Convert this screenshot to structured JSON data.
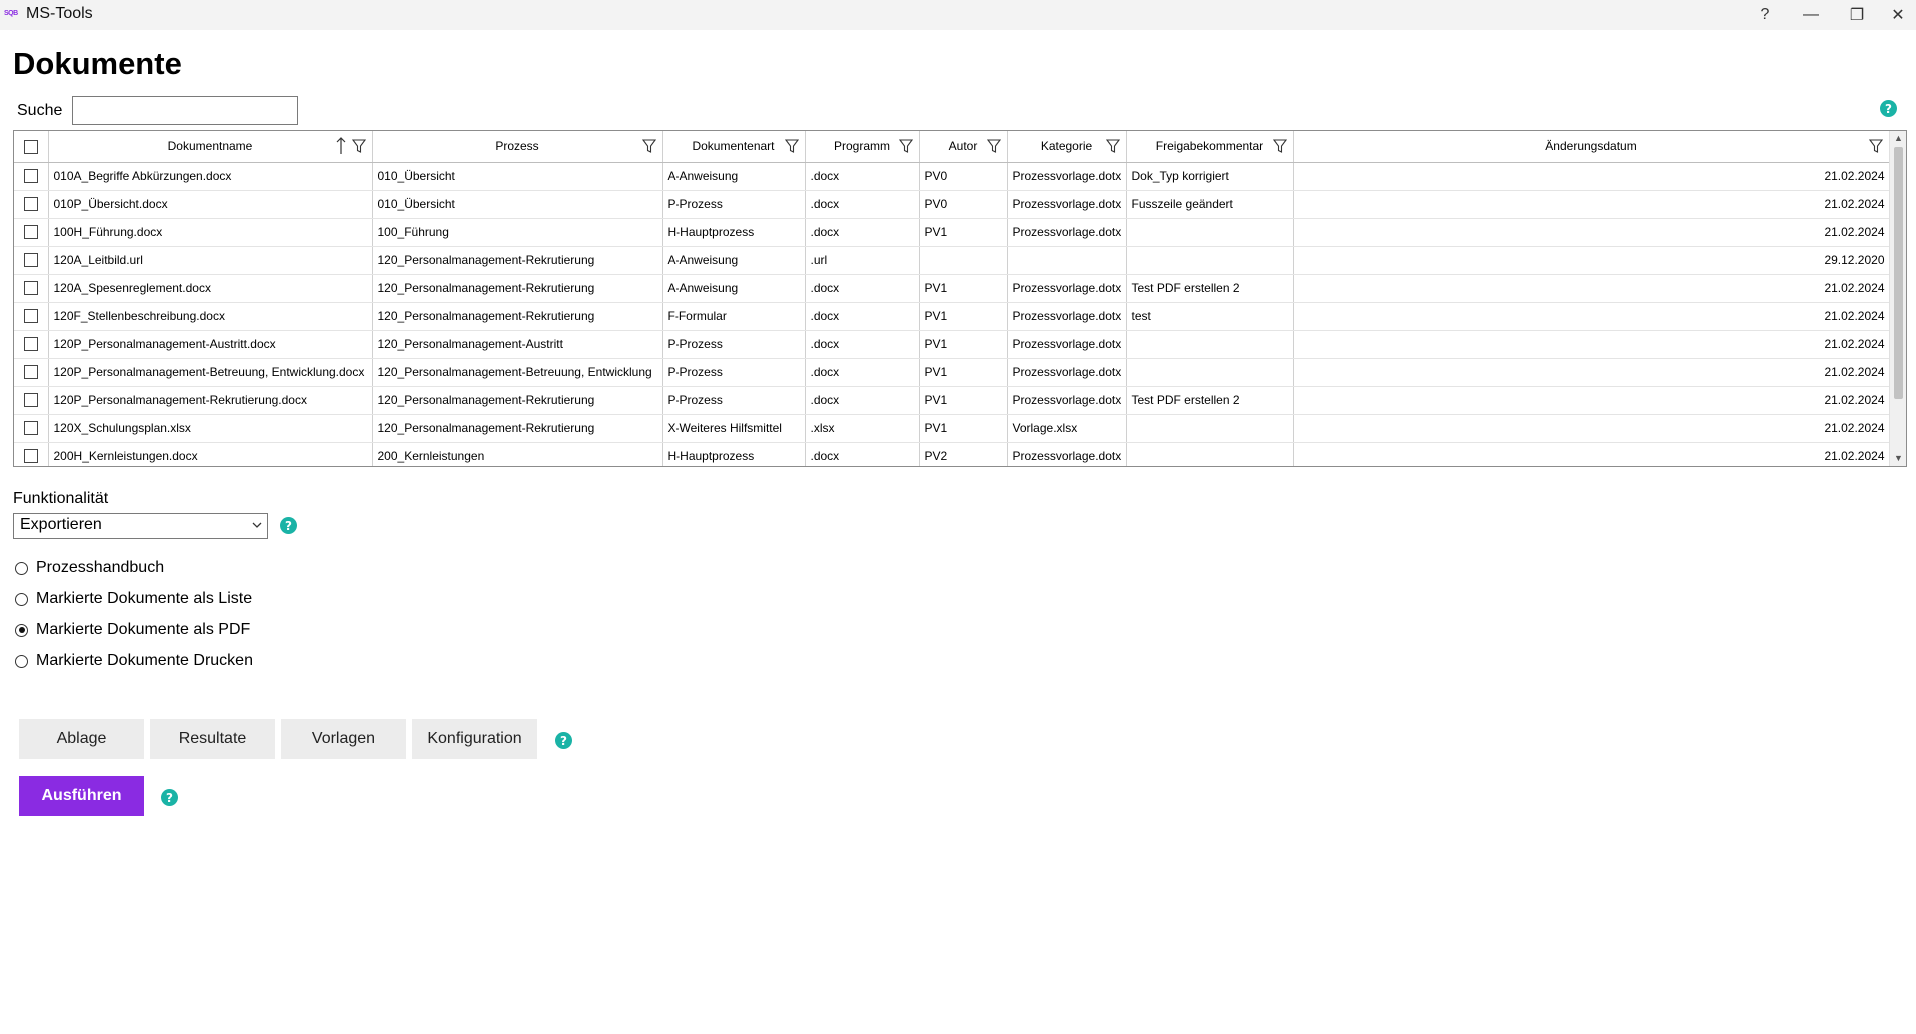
{
  "window": {
    "logo_text": "SQB",
    "title": "MS-Tools",
    "help_glyph": "?",
    "minimize_glyph": "—",
    "maximize_glyph": "❐",
    "close_glyph": "✕"
  },
  "page": {
    "title": "Dokumente"
  },
  "search": {
    "label": "Suche",
    "value": ""
  },
  "help_glyph": "?",
  "grid": {
    "columns": [
      "Dokumentname",
      "Prozess",
      "Dokumentenart",
      "Programm",
      "Autor",
      "Kategorie",
      "Freigabekommentar",
      "Änderungsdatum"
    ],
    "sorted_column": "Dokumentname",
    "sort_direction": "ascending",
    "rows": [
      [
        "010A_Begriffe Abkürzungen.docx",
        "010_Übersicht",
        "A-Anweisung",
        ".docx",
        "PV0",
        "Prozessvorlage.dotx",
        "Dok_Typ korrigiert",
        "21.02.2024"
      ],
      [
        "010P_Übersicht.docx",
        "010_Übersicht",
        "P-Prozess",
        ".docx",
        "PV0",
        "Prozessvorlage.dotx",
        "Fusszeile geändert",
        "21.02.2024"
      ],
      [
        "100H_Führung.docx",
        "100_Führung",
        "H-Hauptprozess",
        ".docx",
        "PV1",
        "Prozessvorlage.dotx",
        "",
        "21.02.2024"
      ],
      [
        "120A_Leitbild.url",
        "120_Personalmanagement-Rekrutierung",
        "A-Anweisung",
        ".url",
        "",
        "",
        "",
        "29.12.2020"
      ],
      [
        "120A_Spesenreglement.docx",
        "120_Personalmanagement-Rekrutierung",
        "A-Anweisung",
        ".docx",
        "PV1",
        "Prozessvorlage.dotx",
        "Test PDF erstellen 2",
        "21.02.2024"
      ],
      [
        "120F_Stellenbeschreibung.docx",
        "120_Personalmanagement-Rekrutierung",
        "F-Formular",
        ".docx",
        "PV1",
        "Prozessvorlage.dotx",
        "test",
        "21.02.2024"
      ],
      [
        "120P_Personalmanagement-Austritt.docx",
        "120_Personalmanagement-Austritt",
        "P-Prozess",
        ".docx",
        "PV1",
        "Prozessvorlage.dotx",
        "",
        "21.02.2024"
      ],
      [
        "120P_Personalmanagement-Betreuung, Entwicklung.docx",
        "120_Personalmanagement-Betreuung, Entwicklung",
        "P-Prozess",
        ".docx",
        "PV1",
        "Prozessvorlage.dotx",
        "",
        "21.02.2024"
      ],
      [
        "120P_Personalmanagement-Rekrutierung.docx",
        "120_Personalmanagement-Rekrutierung",
        "P-Prozess",
        ".docx",
        "PV1",
        "Prozessvorlage.dotx",
        "Test PDF erstellen 2",
        "21.02.2024"
      ],
      [
        "120X_Schulungsplan.xlsx",
        "120_Personalmanagement-Rekrutierung",
        "X-Weiteres Hilfsmittel",
        ".xlsx",
        "PV1",
        "Vorlage.xlsx",
        "",
        "21.02.2024"
      ],
      [
        "200H_Kernleistungen.docx",
        "200_Kernleistungen",
        "H-Hauptprozess",
        ".docx",
        "PV2",
        "Prozessvorlage.dotx",
        "",
        "21.02.2024"
      ]
    ]
  },
  "functionality": {
    "label": "Funktionalität",
    "selected": "Exportieren"
  },
  "options": [
    {
      "label": "Prozesshandbuch",
      "checked": false
    },
    {
      "label": "Markierte Dokumente als Liste",
      "checked": false
    },
    {
      "label": "Markierte Dokumente als PDF",
      "checked": true
    },
    {
      "label": "Markierte Dokumente Drucken",
      "checked": false
    }
  ],
  "buttons": {
    "ablage": "Ablage",
    "resultate": "Resultate",
    "vorlagen": "Vorlagen",
    "konfiguration": "Konfiguration",
    "run": "Ausführen"
  },
  "colors": {
    "accent": "#8a2be2",
    "help": "#1ab3a6"
  }
}
